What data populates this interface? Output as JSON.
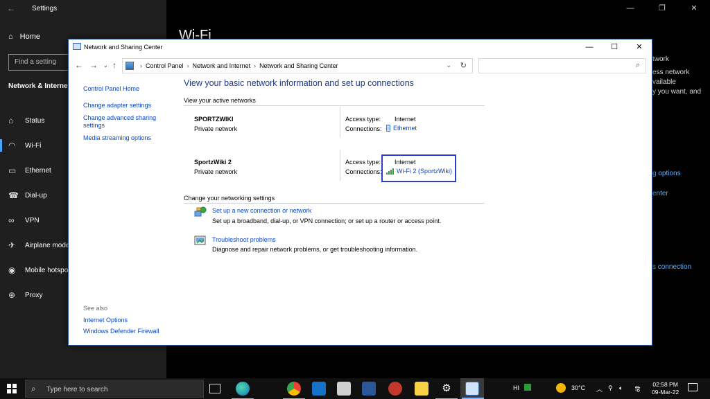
{
  "settings": {
    "title": "Settings",
    "home": "Home",
    "search_placeholder": "Find a setting",
    "section": "Network & Internet",
    "nav": [
      {
        "icon": "globe-icon",
        "glyph": "⌂",
        "label": "Status"
      },
      {
        "icon": "wifi-icon",
        "glyph": "◠",
        "label": "Wi-Fi"
      },
      {
        "icon": "ethernet-icon",
        "glyph": "▭",
        "label": "Ethernet"
      },
      {
        "icon": "phone-icon",
        "glyph": "☎",
        "label": "Dial-up"
      },
      {
        "icon": "vpn-icon",
        "glyph": "∞",
        "label": "VPN"
      },
      {
        "icon": "airplane-icon",
        "glyph": "✈",
        "label": "Airplane mode"
      },
      {
        "icon": "hotspot-icon",
        "glyph": "◉",
        "label": "Mobile hotspot"
      },
      {
        "icon": "proxy-icon",
        "glyph": "⊕",
        "label": "Proxy"
      }
    ],
    "heading": "Wi-Fi",
    "right_texts": [
      "twork",
      "ess network",
      "vailable",
      "y you want, and"
    ],
    "right_links": [
      "g options",
      "enter",
      "s connection"
    ]
  },
  "window": {
    "title": "Network and Sharing Center",
    "breadcrumbs": [
      "Control Panel",
      "Network and Internet",
      "Network and Sharing Center"
    ],
    "sidebar_links": [
      "Control Panel Home",
      "Change adapter settings",
      "Change advanced sharing settings",
      "Media streaming options"
    ],
    "see_also_label": "See also",
    "see_also_links": [
      "Internet Options",
      "Windows Defender Firewall"
    ],
    "heading": "View your basic network information and set up connections",
    "active_label": "View your active networks",
    "networks": [
      {
        "name": "SPORTZWIKI",
        "type": "Private network",
        "access_label": "Access type:",
        "access": "Internet",
        "conn_label": "Connections:",
        "conn": "Ethernet"
      },
      {
        "name": "SportzWiki 2",
        "type": "Private network",
        "access_label": "Access type:",
        "access": "Internet",
        "conn_label": "Connections:",
        "conn": "Wi-Fi 2 (SportzWiki)"
      }
    ],
    "change_label": "Change your networking settings",
    "tasks": [
      {
        "link": "Set up a new connection or network",
        "desc": "Set up a broadband, dial-up, or VPN connection; or set up a router or access point."
      },
      {
        "link": "Troubleshoot problems",
        "desc": "Diagnose and repair network problems, or get troubleshooting information."
      }
    ]
  },
  "taskbar": {
    "search_placeholder": "Type here to search",
    "lang": "HI",
    "temperature": "30°C",
    "ime": "हि",
    "time": "02:58 PM",
    "date": "09-Mar-22"
  },
  "colors": {
    "link": "#0a47c2",
    "heading": "#1e3a8a",
    "highlight": "#2d3dc9",
    "accent": "#4aa3ff"
  }
}
